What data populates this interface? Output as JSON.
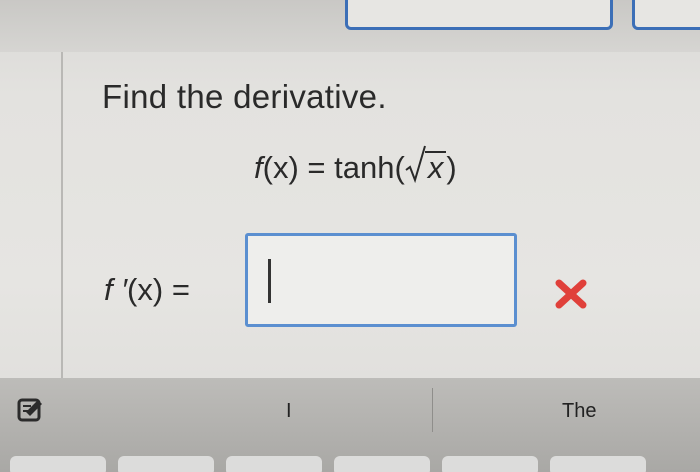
{
  "question": {
    "prompt": "Find the derivative.",
    "function_name": "f",
    "function_arg": "(x)",
    "equals": "=",
    "function_expr_prefix": "tanh(",
    "sqrt_arg": "x",
    "function_expr_suffix": ")"
  },
  "answer": {
    "label_name": "f ′",
    "label_arg": "(x)",
    "equals": "=",
    "value": "",
    "status_icon": "red-x-icon"
  },
  "keyboard": {
    "suggestions": [
      "I",
      "The"
    ]
  },
  "colors": {
    "accent": "#3c6fb7",
    "input_border": "#5b8fd0",
    "error": "#e0403a"
  }
}
